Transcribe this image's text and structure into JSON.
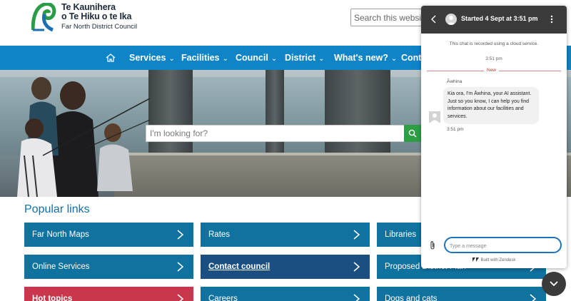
{
  "header": {
    "logo_line1": "Te Kaunihera",
    "logo_line2": "o Te Hiku o te Ika",
    "logo_line3": "Far North District Council",
    "search_placeholder": "Search this website"
  },
  "nav": {
    "items": [
      {
        "label": "Services"
      },
      {
        "label": "Facilities"
      },
      {
        "label": "Council"
      },
      {
        "label": "District"
      },
      {
        "label": "What's new?"
      },
      {
        "label": "Conta"
      }
    ]
  },
  "hero": {
    "search_placeholder": "I'm looking for?"
  },
  "popular_links": {
    "heading": "Popular links",
    "tiles": [
      {
        "label": "Far North Maps"
      },
      {
        "label": "Rates"
      },
      {
        "label": "Libraries"
      },
      {
        "label": "Online Services"
      },
      {
        "label": "Contact council"
      },
      {
        "label": "Proposed District Plan"
      },
      {
        "label": "Hot topics"
      },
      {
        "label": "Careers"
      },
      {
        "label": "Dogs and cats"
      }
    ]
  },
  "chat": {
    "title": "Started 4 Sept at 3:51 pm",
    "notice": "This chat is recorded using a cloud service.",
    "time_top": "3:51 pm",
    "divider": "New",
    "sender": "Āwhina",
    "message": "Kia ora, I'm Āwhina, your AI assistant. Just so you know, I can help you find information about our facilities and services.",
    "time_msg": "3:51 pm",
    "input_placeholder": "Type a message",
    "built_with": "Built with Zendesk"
  },
  "colors": {
    "nav_blue": "#0f84c7",
    "tile_teal": "#10729f",
    "tile_dark": "#1b4f82",
    "tile_red": "#c8374c",
    "search_green": "#2e9e44",
    "chat_header": "#3b3b3b"
  },
  "icons": [
    "home-icon",
    "chevron-down-icon",
    "search-icon",
    "chevron-right-icon",
    "back-arrow-icon",
    "more-vertical-icon",
    "paperclip-icon",
    "zendesk-icon",
    "chevron-down-icon"
  ]
}
